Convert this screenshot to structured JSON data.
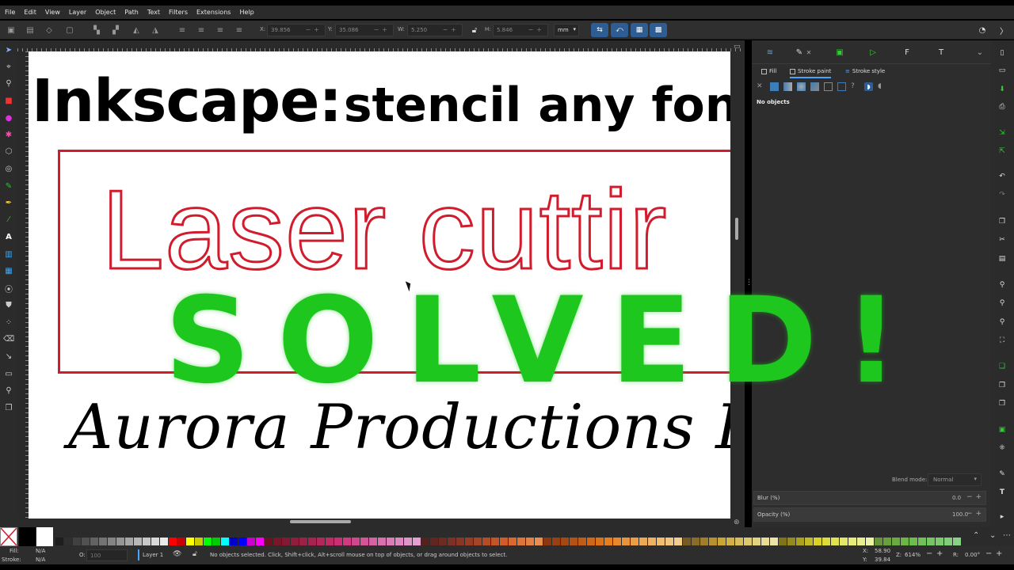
{
  "menu": [
    "File",
    "Edit",
    "View",
    "Layer",
    "Object",
    "Path",
    "Text",
    "Filters",
    "Extensions",
    "Help"
  ],
  "toolbar": {
    "x_label": "X:",
    "x_value": "39.856",
    "y_label": "Y:",
    "y_value": "35.086",
    "w_label": "W:",
    "w_value": "5.250",
    "h_label": "H:",
    "h_value": "5.846",
    "unit": "mm"
  },
  "canvas": {
    "headline_big": "Inkscape:",
    "headline_small": "stencil any font",
    "laser_text": "Laser cuttir",
    "script_text": "Aurora Productions Fi",
    "overlay_text": "SOLVED!",
    "colors": {
      "red": "#d01c2c",
      "green": "#1ec71e"
    }
  },
  "dock": {
    "tabs": {
      "fill": "Fill",
      "stroke_paint": "Stroke paint",
      "stroke_style": "Stroke style"
    },
    "no_objects": "No objects",
    "blend_mode_label": "Blend mode:",
    "blend_mode_value": "Normal",
    "blur_label": "Blur (%)",
    "blur_value": "0.0",
    "opacity_label": "Opacity (%)",
    "opacity_value": "100.0"
  },
  "status": {
    "fill_label": "Fill:",
    "fill_value": "N/A",
    "stroke_label": "Stroke:",
    "stroke_value": "N/A",
    "o_label": "O:",
    "o_value": "100",
    "layer": "Layer 1",
    "message": "No objects selected. Click, Shift+click, Alt+scroll mouse on top of objects, or drag around objects to select.",
    "x_label": "X:",
    "x_value": "58.90",
    "y_label": "Y:",
    "y_value": "39.84",
    "z_label": "Z:",
    "zoom": "614%",
    "r_label": "R:",
    "rotation": "0.00°"
  }
}
